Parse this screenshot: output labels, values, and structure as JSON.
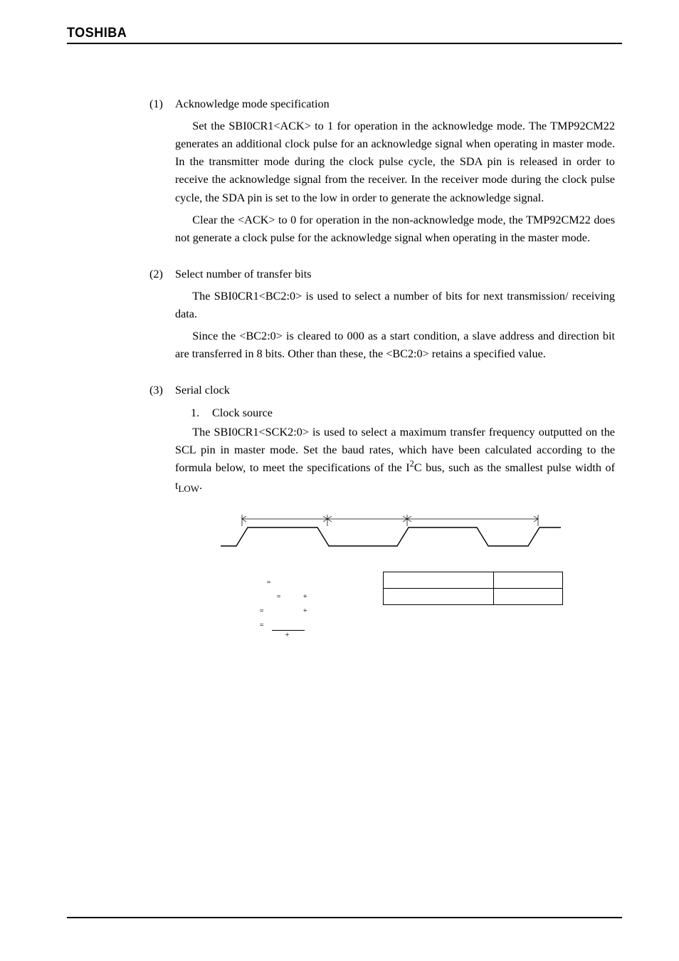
{
  "brand": "TOSHIBA",
  "sections": {
    "s1": {
      "num": "(1)",
      "title": "Acknowledge mode specification",
      "p1": "Set the SBI0CR1<ACK> to 1 for operation in the acknowledge mode. The TMP92CM22 generates an additional clock pulse for an acknowledge signal when operating in master mode. In the transmitter mode during the clock pulse cycle, the SDA pin is released in order to receive the acknowledge signal from the receiver. In the receiver mode during the clock pulse cycle, the SDA pin is set to the low in order to generate the acknowledge signal.",
      "p2": "Clear the <ACK> to 0 for operation in the non-acknowledge mode, the TMP92CM22 does not generate a clock pulse for the acknowledge signal when operating in the master mode."
    },
    "s2": {
      "num": "(2)",
      "title": "Select number of transfer bits",
      "p1": "The SBI0CR1<BC2:0> is used to select a number of bits for next transmission/ receiving data.",
      "p2": "Since the <BC2:0> is cleared to 000 as a start condition, a slave address and direction bit are transferred in 8 bits. Other than these, the <BC2:0> retains a specified value."
    },
    "s3": {
      "num": "(3)",
      "title": "Serial clock",
      "sub_num": "1.",
      "sub_title": "Clock source",
      "p1_a": "The SBI0CR1<SCK2:0> is used to select a maximum transfer frequency outputted on the SCL pin in master mode. Set the baud rates, which have been calculated according to the formula below, to meet the specifications of the I",
      "p1_b": "C bus, such as the smallest pulse width of t",
      "p1_c": "."
    }
  },
  "figure": {
    "eq_eq": "=",
    "eq_plus": "+",
    "table_header_c1": "",
    "table_header_c2": ""
  }
}
